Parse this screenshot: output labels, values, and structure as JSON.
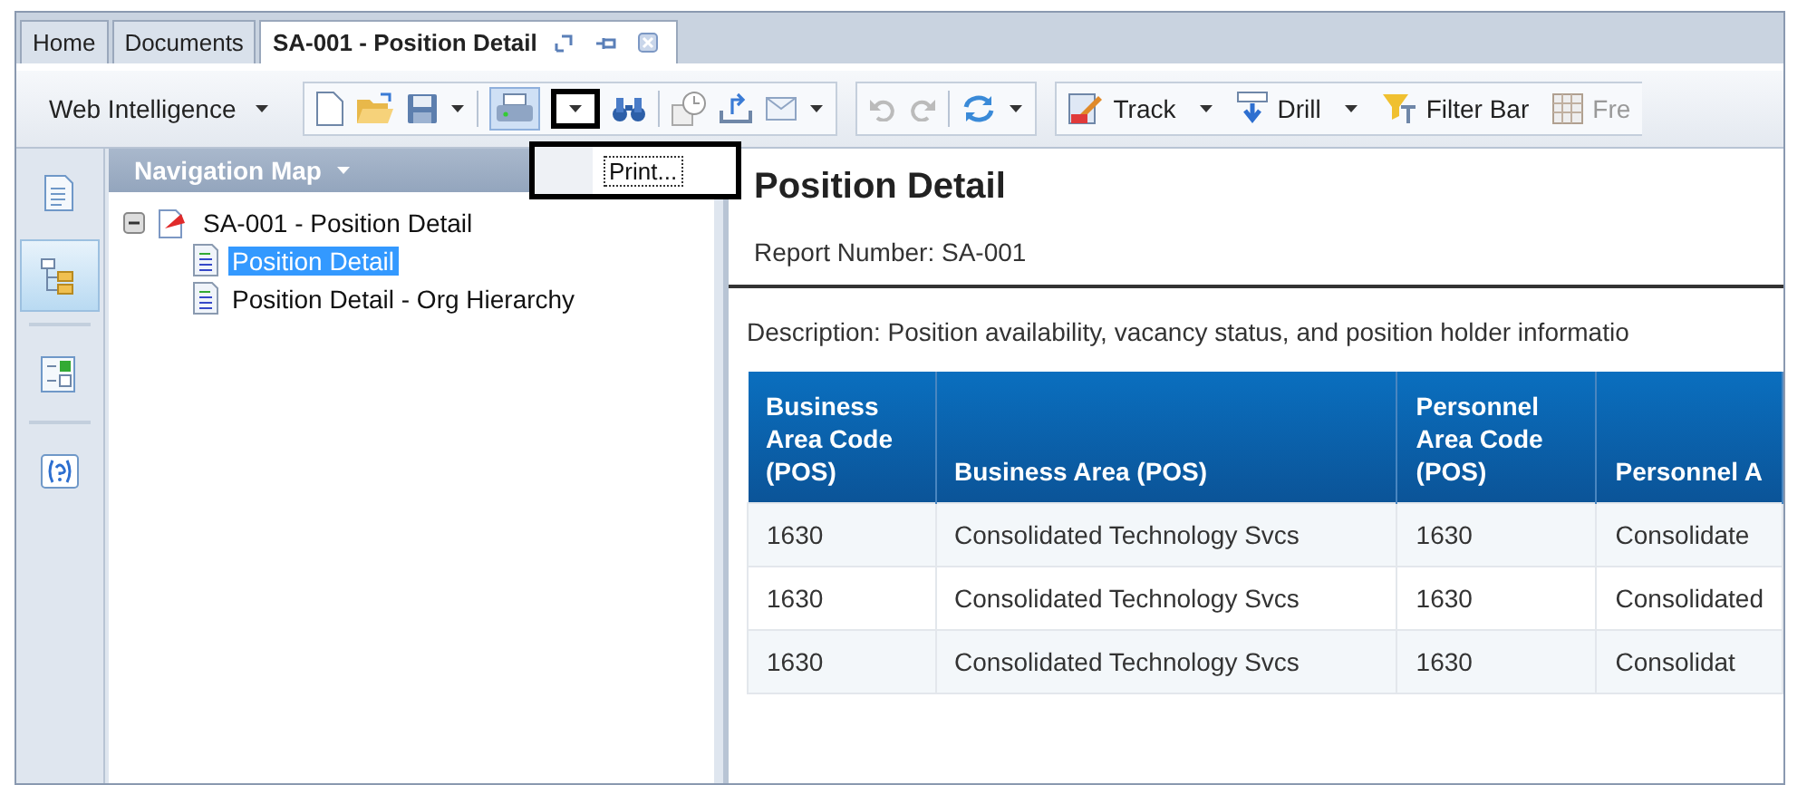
{
  "tabs": [
    {
      "label": "Home",
      "selected": false
    },
    {
      "label": "Documents",
      "selected": false
    },
    {
      "label": "SA-001 - Position Detail",
      "selected": true
    }
  ],
  "toolbar": {
    "app_menu": "Web Intelligence",
    "print_menu": {
      "open": true,
      "items": [
        {
          "label": "Print..."
        }
      ]
    },
    "buttons": [
      {
        "label": "Track"
      },
      {
        "label": "Drill"
      },
      {
        "label": "Filter Bar"
      },
      {
        "label": "Fre"
      }
    ]
  },
  "side_tabs": [
    {
      "selected": false
    },
    {
      "selected": true
    },
    {
      "selected": false
    },
    {
      "selected": false
    }
  ],
  "navigation_map": {
    "title": "Navigation Map",
    "tree": [
      {
        "label": "SA-001 - Position Detail",
        "expanded": true,
        "children": [
          {
            "label": "Position Detail",
            "selected": true
          },
          {
            "label": "Position Detail - Org Hierarchy",
            "selected": false
          }
        ]
      }
    ]
  },
  "report": {
    "title": "Position Detail",
    "report_number": "Report Number: SA-001",
    "description": "Description: Position availability, vacancy status, and position holder informatio",
    "table": {
      "columns": [
        "Business Area Code (POS)",
        "Business Area (POS)",
        "Personnel Area Code (POS)",
        "Personnel A"
      ],
      "rows": [
        [
          "1630",
          "Consolidated Technology Svcs",
          "1630",
          "Consolidate"
        ],
        [
          "1630",
          "Consolidated Technology Svcs",
          "1630",
          "Consolidated"
        ],
        [
          "1630",
          "Consolidated Technology Svcs",
          "1630",
          "Consolidat"
        ]
      ]
    }
  }
}
